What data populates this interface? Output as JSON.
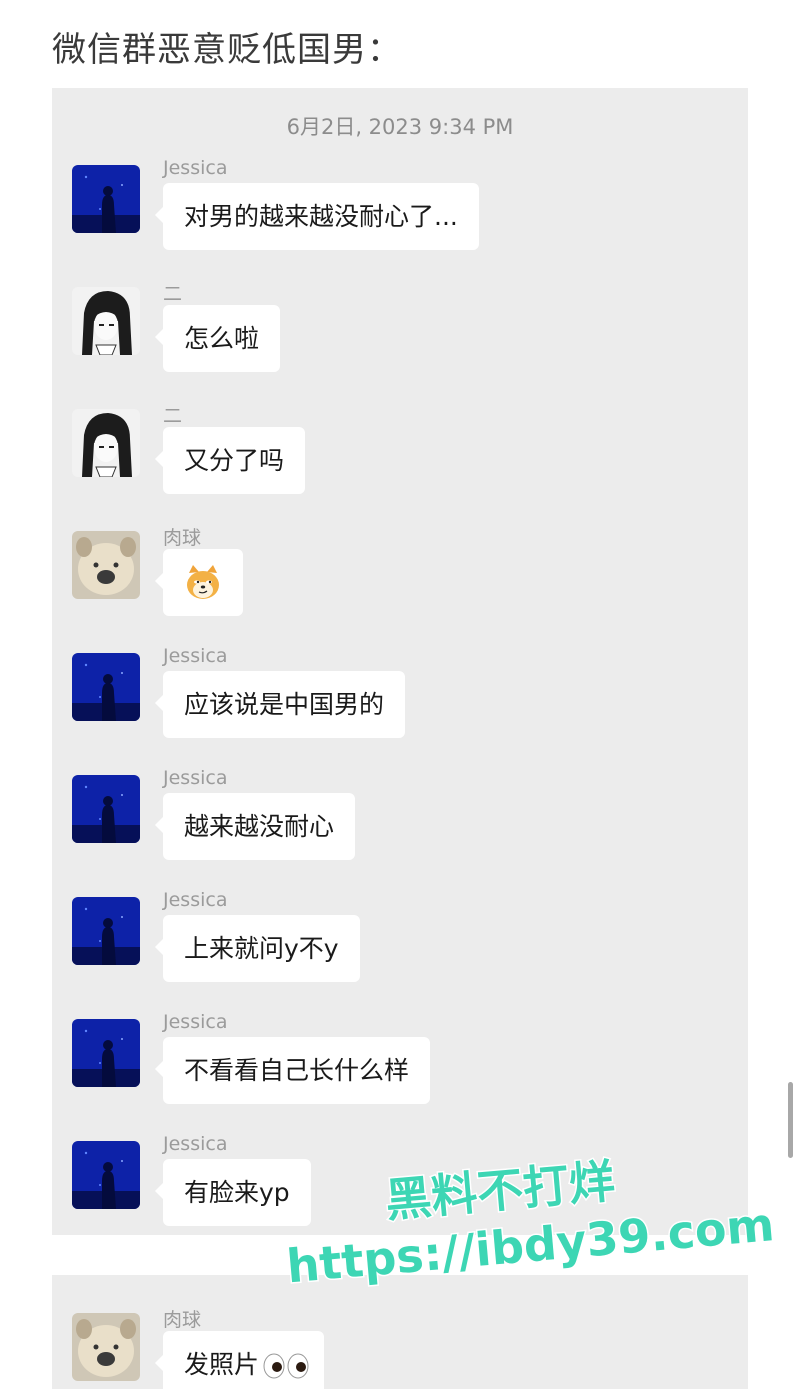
{
  "page": {
    "title": "微信群恶意贬低国男："
  },
  "chat": {
    "timestamp": "6月2日, 2023 9:34 PM",
    "messages": [
      {
        "sender": "Jessica",
        "text": "对男的越来越没耐心了...",
        "avatar": "blue-silhouette"
      },
      {
        "sender": "二",
        "text": "怎么啦",
        "avatar": "manga-girl"
      },
      {
        "sender": "二",
        "text": "又分了吗",
        "avatar": "manga-girl"
      },
      {
        "sender": "肉球",
        "emoji": "doge-emoji",
        "avatar": "dog-face"
      },
      {
        "sender": "Jessica",
        "text": "应该说是中国男的",
        "avatar": "blue-silhouette"
      },
      {
        "sender": "Jessica",
        "text": "越来越没耐心",
        "avatar": "blue-silhouette"
      },
      {
        "sender": "Jessica",
        "text": "上来就问y不y",
        "avatar": "blue-silhouette"
      },
      {
        "sender": "Jessica",
        "text": "不看看自己长什么样",
        "avatar": "blue-silhouette"
      },
      {
        "sender": "Jessica",
        "text": "有脸来yp",
        "avatar": "blue-silhouette"
      }
    ],
    "continued": [
      {
        "sender": "肉球",
        "text": "发照片",
        "emoji": "eyes-emoji",
        "avatar": "dog-face"
      }
    ]
  },
  "watermark": {
    "line1": "黑料不打烊",
    "line2": "https://ibdy39.com",
    "color": "#3dd6b4"
  }
}
